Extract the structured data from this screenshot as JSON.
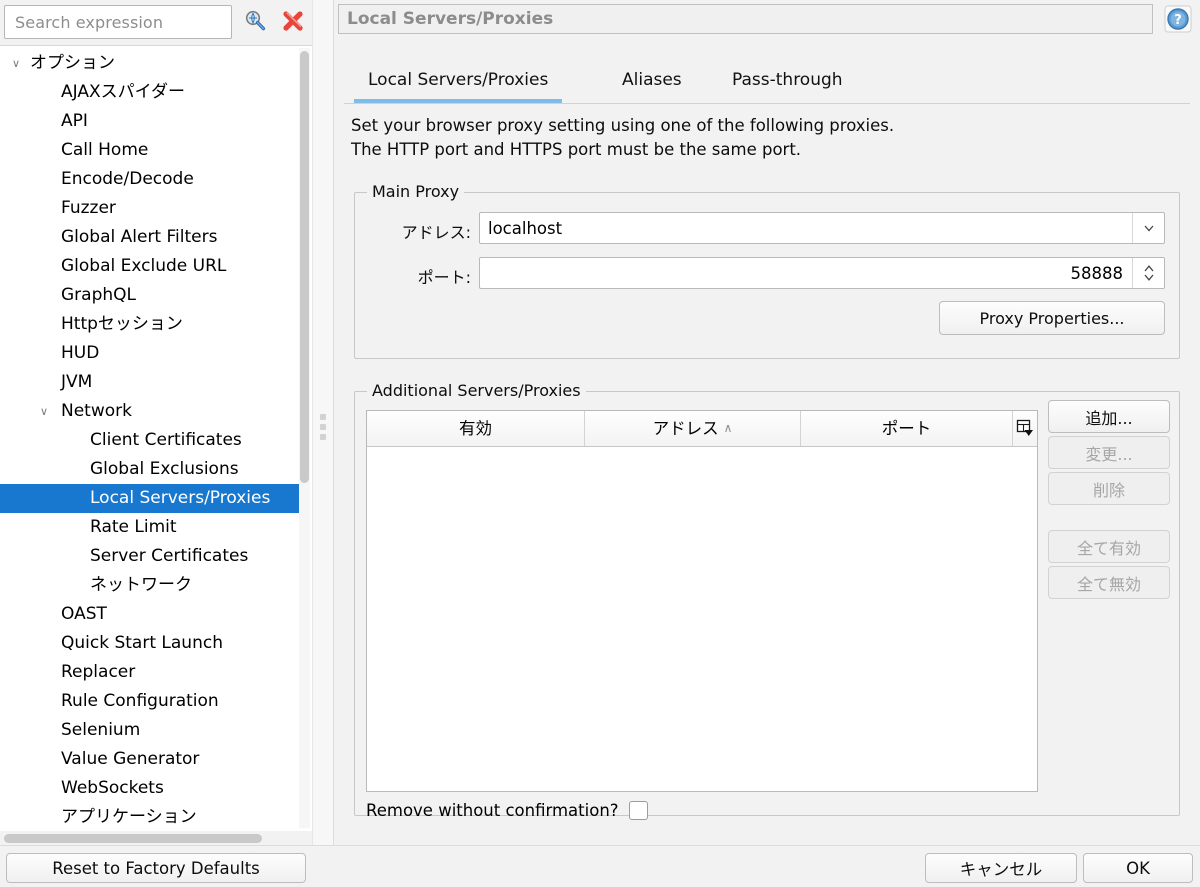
{
  "search": {
    "placeholder": "Search expression",
    "search_icon": "magnifier-icon",
    "clear_icon": "red-x-icon"
  },
  "sidebar": {
    "items": [
      {
        "label": "オプション",
        "level": 0,
        "chevron": "∨",
        "selected": false
      },
      {
        "label": "AJAXスパイダー",
        "level": 1,
        "chevron": "",
        "selected": false
      },
      {
        "label": "API",
        "level": 1,
        "chevron": "",
        "selected": false
      },
      {
        "label": "Call Home",
        "level": 1,
        "chevron": "",
        "selected": false
      },
      {
        "label": "Encode/Decode",
        "level": 1,
        "chevron": "",
        "selected": false
      },
      {
        "label": "Fuzzer",
        "level": 1,
        "chevron": "",
        "selected": false
      },
      {
        "label": "Global Alert Filters",
        "level": 1,
        "chevron": "",
        "selected": false
      },
      {
        "label": "Global Exclude URL",
        "level": 1,
        "chevron": "",
        "selected": false
      },
      {
        "label": "GraphQL",
        "level": 1,
        "chevron": "",
        "selected": false
      },
      {
        "label": "Httpセッション",
        "level": 1,
        "chevron": "",
        "selected": false
      },
      {
        "label": "HUD",
        "level": 1,
        "chevron": "",
        "selected": false
      },
      {
        "label": "JVM",
        "level": 1,
        "chevron": "",
        "selected": false
      },
      {
        "label": "Network",
        "level": 1,
        "chevron": "∨",
        "selected": false
      },
      {
        "label": "Client Certificates",
        "level": 2,
        "chevron": "",
        "selected": false
      },
      {
        "label": "Global Exclusions",
        "level": 2,
        "chevron": "",
        "selected": false
      },
      {
        "label": "Local Servers/Proxies",
        "level": 2,
        "chevron": "",
        "selected": true
      },
      {
        "label": "Rate Limit",
        "level": 2,
        "chevron": "",
        "selected": false
      },
      {
        "label": "Server Certificates",
        "level": 2,
        "chevron": "",
        "selected": false
      },
      {
        "label": "ネットワーク",
        "level": 2,
        "chevron": "",
        "selected": false
      },
      {
        "label": "OAST",
        "level": 1,
        "chevron": "",
        "selected": false
      },
      {
        "label": "Quick Start Launch",
        "level": 1,
        "chevron": "",
        "selected": false
      },
      {
        "label": "Replacer",
        "level": 1,
        "chevron": "",
        "selected": false
      },
      {
        "label": "Rule Configuration",
        "level": 1,
        "chevron": "",
        "selected": false
      },
      {
        "label": "Selenium",
        "level": 1,
        "chevron": "",
        "selected": false
      },
      {
        "label": "Value Generator",
        "level": 1,
        "chevron": "",
        "selected": false
      },
      {
        "label": "WebSockets",
        "level": 1,
        "chevron": "",
        "selected": false
      },
      {
        "label": "アプリケーション",
        "level": 1,
        "chevron": "",
        "selected": false
      }
    ],
    "selection_color": "#1878cf"
  },
  "panel": {
    "title": "Local Servers/Proxies",
    "help_icon": "help-question-icon",
    "tabs": [
      {
        "label": "Local Servers/Proxies",
        "active": true
      },
      {
        "label": "Aliases",
        "active": false
      },
      {
        "label": "Pass-through",
        "active": false
      }
    ],
    "tab_underline_color": "#7fbce8",
    "description_line1": "Set your browser proxy setting using one of the following proxies.",
    "description_line2": "The HTTP port and HTTPS port must be the same port."
  },
  "main_proxy": {
    "legend": "Main Proxy",
    "address_label": "アドレス:",
    "address_value": "localhost",
    "address_dropdown_icon": "chevron-down-icon",
    "port_label": "ポート:",
    "port_value": "58888",
    "port_spinner_icon": "spinner-updown-icon",
    "proxy_properties_button": "Proxy Properties..."
  },
  "additional": {
    "legend": "Additional Servers/Proxies",
    "columns": [
      {
        "label": "有効",
        "sort": ""
      },
      {
        "label": "アドレス",
        "sort": "∧"
      },
      {
        "label": "ポート",
        "sort": ""
      },
      {
        "label": "",
        "sort": ""
      }
    ],
    "column_chooser_icon": "column-chooser-icon",
    "rows": [],
    "buttons": [
      {
        "label": "追加...",
        "enabled": true
      },
      {
        "label": "変更...",
        "enabled": false
      },
      {
        "label": "削除",
        "enabled": false
      },
      {
        "label": "全て有効",
        "enabled": false
      },
      {
        "label": "全て無効",
        "enabled": false
      }
    ],
    "remove_confirm_label": "Remove without confirmation?",
    "remove_confirm_checked": false
  },
  "bottom": {
    "reset_label": "Reset to Factory Defaults",
    "cancel_label": "キャンセル",
    "ok_label": "OK"
  }
}
